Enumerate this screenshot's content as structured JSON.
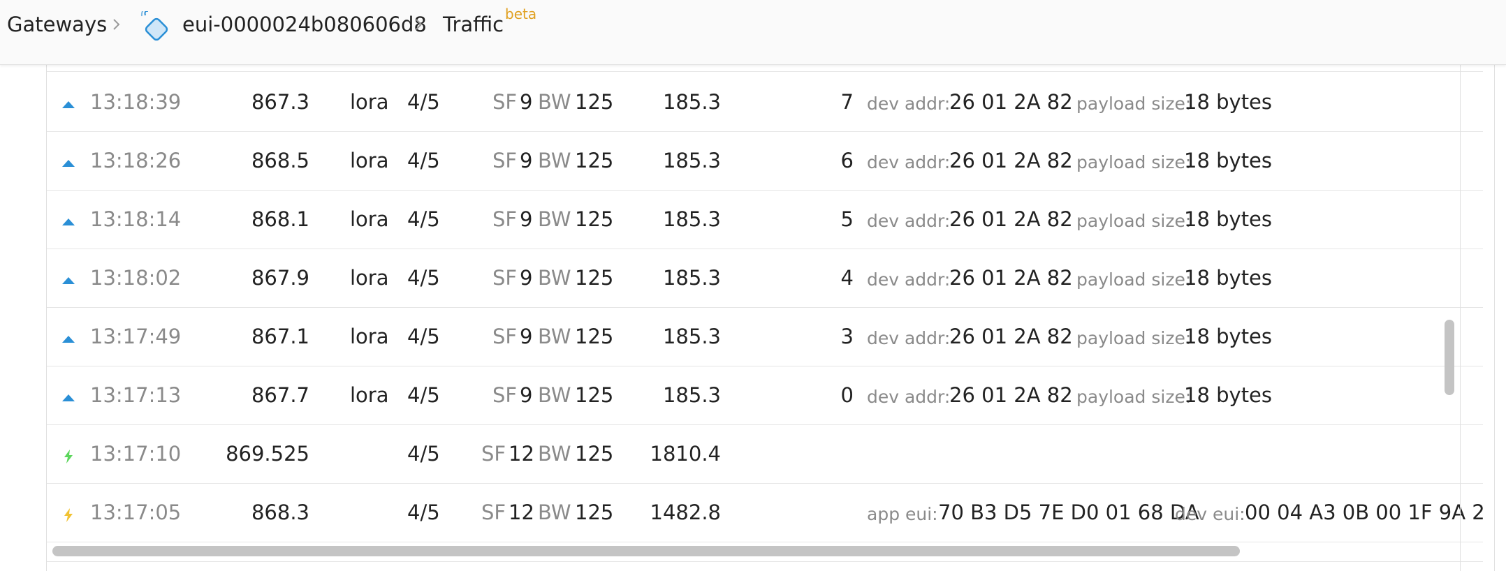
{
  "breadcrumb": {
    "gateways": "Gateways",
    "gateway_id": "eui-0000024b080606d8",
    "traffic": "Traffic",
    "badge": "beta"
  },
  "colors": {
    "uplink": "#2a8fd6",
    "join": "#f1c232",
    "downlink": "#5cd65c",
    "badge": "#e0a020"
  },
  "labels": {
    "sf": "SF",
    "bw": "BW",
    "dev_addr": "dev addr:",
    "payload_size": "payload size:",
    "app_eui": "app eui:",
    "dev_eui": "dev eui:"
  },
  "rows": [
    {
      "icon": "uplink-arrow-icon",
      "time": "13:18:39",
      "freq": "867.3",
      "mod": "lora",
      "cr": "4/5",
      "sf": "9",
      "bw": "125",
      "airtime": "185.3",
      "fcnt": "7",
      "dev_addr": "26 01 2A 82",
      "payload": "18 bytes"
    },
    {
      "icon": "uplink-arrow-icon",
      "time": "13:18:26",
      "freq": "868.5",
      "mod": "lora",
      "cr": "4/5",
      "sf": "9",
      "bw": "125",
      "airtime": "185.3",
      "fcnt": "6",
      "dev_addr": "26 01 2A 82",
      "payload": "18 bytes"
    },
    {
      "icon": "uplink-arrow-icon",
      "time": "13:18:14",
      "freq": "868.1",
      "mod": "lora",
      "cr": "4/5",
      "sf": "9",
      "bw": "125",
      "airtime": "185.3",
      "fcnt": "5",
      "dev_addr": "26 01 2A 82",
      "payload": "18 bytes"
    },
    {
      "icon": "uplink-arrow-icon",
      "time": "13:18:02",
      "freq": "867.9",
      "mod": "lora",
      "cr": "4/5",
      "sf": "9",
      "bw": "125",
      "airtime": "185.3",
      "fcnt": "4",
      "dev_addr": "26 01 2A 82",
      "payload": "18 bytes"
    },
    {
      "icon": "uplink-arrow-icon",
      "time": "13:17:49",
      "freq": "867.1",
      "mod": "lora",
      "cr": "4/5",
      "sf": "9",
      "bw": "125",
      "airtime": "185.3",
      "fcnt": "3",
      "dev_addr": "26 01 2A 82",
      "payload": "18 bytes"
    },
    {
      "icon": "uplink-arrow-icon",
      "time": "13:17:13",
      "freq": "867.7",
      "mod": "lora",
      "cr": "4/5",
      "sf": "9",
      "bw": "125",
      "airtime": "185.3",
      "fcnt": "0",
      "dev_addr": "26 01 2A 82",
      "payload": "18 bytes"
    },
    {
      "icon": "downlink-bolt-icon",
      "time": "13:17:10",
      "freq": "869.525",
      "cr": "4/5",
      "sf": "12",
      "bw": "125",
      "airtime": "1810.4"
    },
    {
      "icon": "join-bolt-icon",
      "time": "13:17:05",
      "freq": "868.3",
      "cr": "4/5",
      "sf": "12",
      "bw": "125",
      "airtime": "1482.8",
      "app_eui": "70 B3 D5 7E D0 01 68 DA",
      "dev_eui": "00 04 A3 0B 00 1F 9A 2"
    }
  ]
}
